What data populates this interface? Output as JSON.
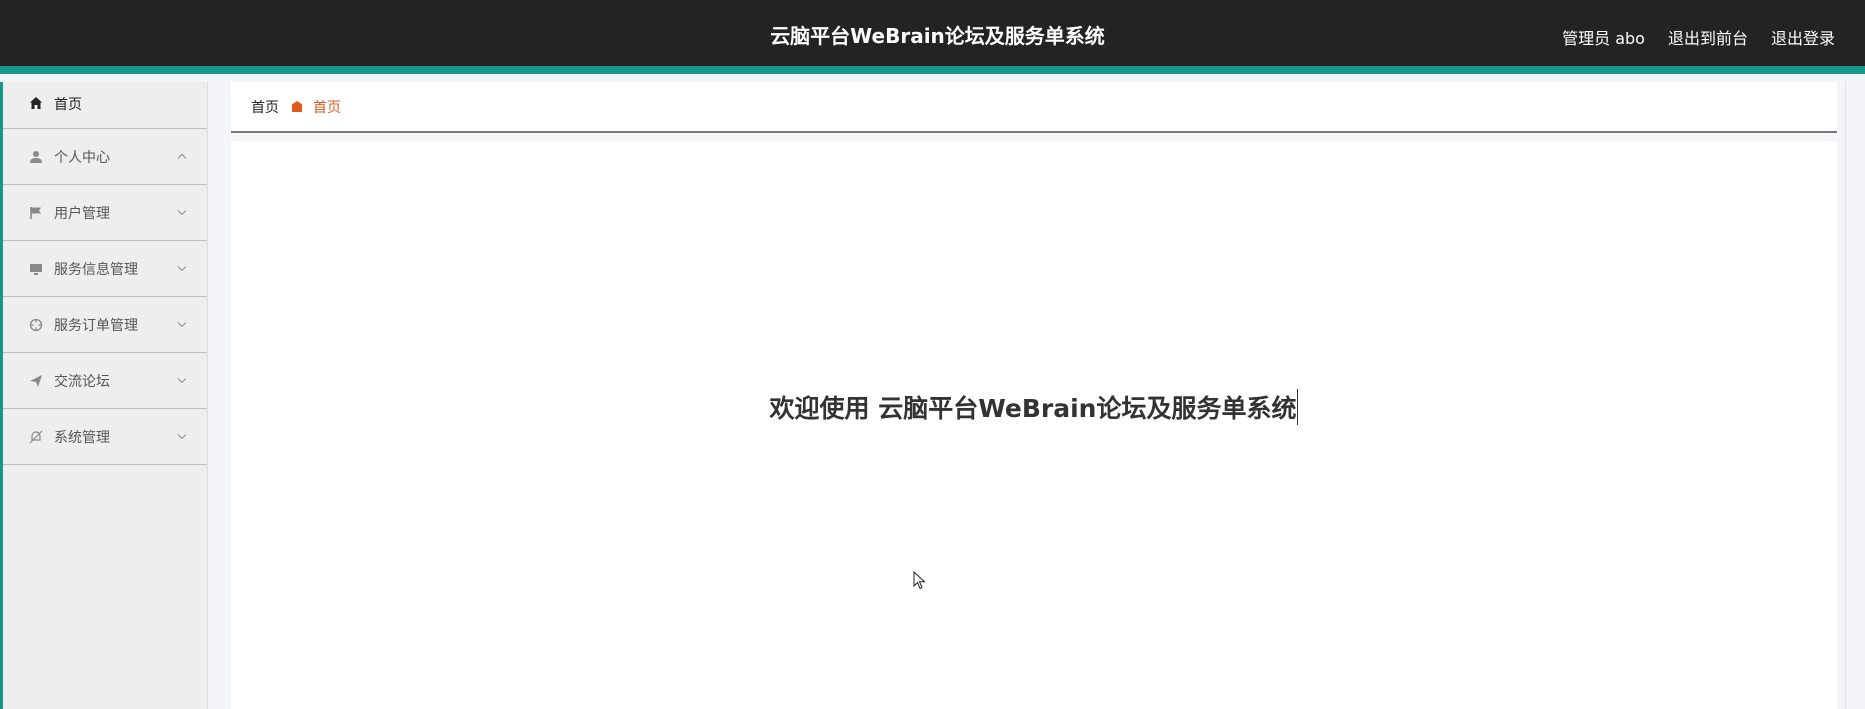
{
  "header": {
    "title": "云脑平台WeBrain论坛及服务单系统",
    "user_label": "管理员 abo",
    "to_frontend": "退出到前台",
    "logout": "退出登录"
  },
  "sidebar": {
    "items": [
      {
        "label": "首页",
        "icon": "home-icon"
      },
      {
        "label": "个人中心",
        "icon": "person-icon",
        "chevron": "up"
      },
      {
        "label": "用户管理",
        "icon": "flag-icon",
        "chevron": "down"
      },
      {
        "label": "服务信息管理",
        "icon": "monitor-icon",
        "chevron": "down"
      },
      {
        "label": "服务订单管理",
        "icon": "crosshair-icon",
        "chevron": "down"
      },
      {
        "label": "交流论坛",
        "icon": "send-icon",
        "chevron": "down"
      },
      {
        "label": "系统管理",
        "icon": "bell-off-icon",
        "chevron": "down"
      }
    ]
  },
  "breadcrumb": {
    "root": "首页",
    "current": "首页"
  },
  "main": {
    "welcome": "欢迎使用 云脑平台WeBrain论坛及服务单系统"
  },
  "colors": {
    "header_bg": "#242224",
    "accent": "#17998a",
    "breadcrumb_active": "#e05a1e"
  }
}
